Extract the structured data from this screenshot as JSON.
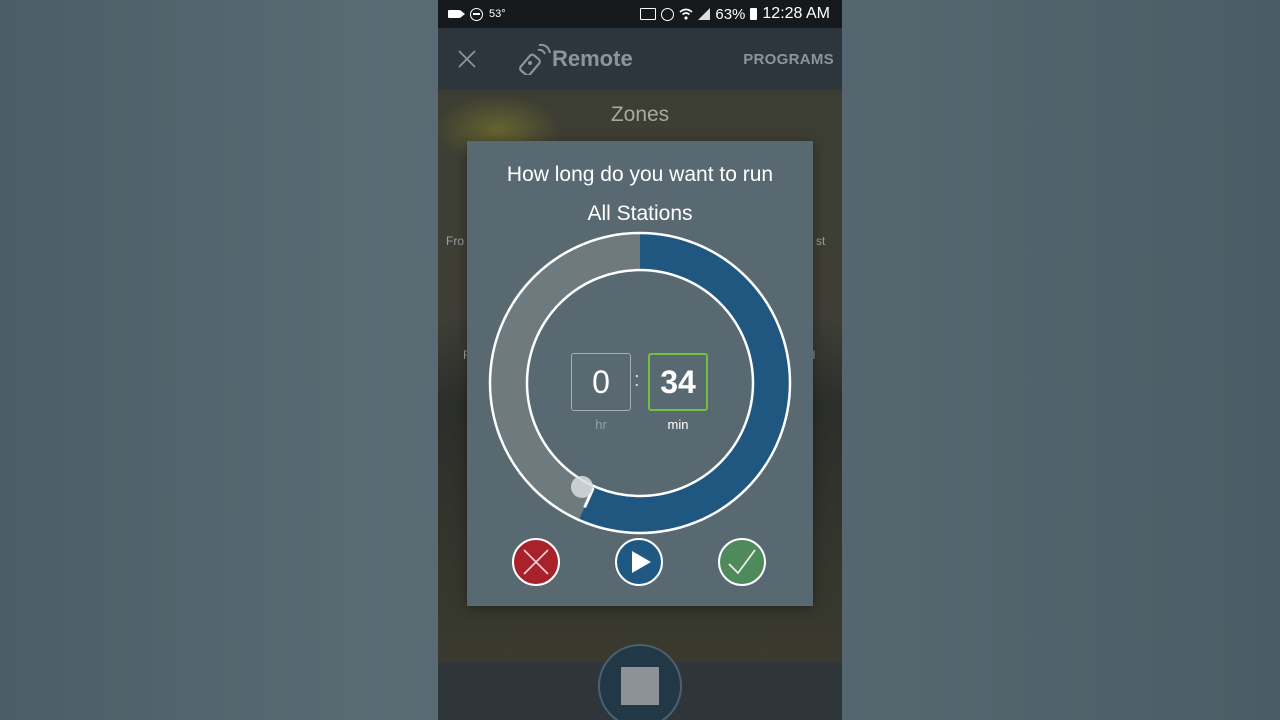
{
  "status_bar": {
    "temperature": "53°",
    "battery": "63%",
    "time": "12:28 AM",
    "icons": [
      "video-icon",
      "dnd-icon",
      "cast-icon",
      "alarm-icon",
      "wifi-icon",
      "signal-icon",
      "battery-icon"
    ]
  },
  "header": {
    "title": "Remote",
    "programs_label": "PROGRAMS",
    "close_icon": "close-icon",
    "logo_icon": "remote-control-icon"
  },
  "background": {
    "zones_title": "Zones",
    "fragment_left_1": "Fro",
    "fragment_right_1": "st",
    "fragment_left_2": "F",
    "fragment_right_2": "ll"
  },
  "dialog": {
    "question": "How long do you want to run",
    "target": "All Stations",
    "hours_value": "0",
    "hours_label": "hr",
    "separator": ":",
    "minutes_value": "34",
    "minutes_label": "min",
    "dial_fraction": 0.5667,
    "colors": {
      "dial_fill": "#1f5780",
      "dial_track": "#6f7a7f",
      "minutes_border": "#6fc23a",
      "cancel": "#a8212b",
      "play": "#1e5883",
      "confirm": "#4f8a5c"
    },
    "actions": {
      "cancel_icon": "x-icon",
      "play_icon": "play-icon",
      "confirm_icon": "checkmark-icon"
    }
  },
  "bottom_bar": {
    "stop_icon": "stop-icon"
  }
}
